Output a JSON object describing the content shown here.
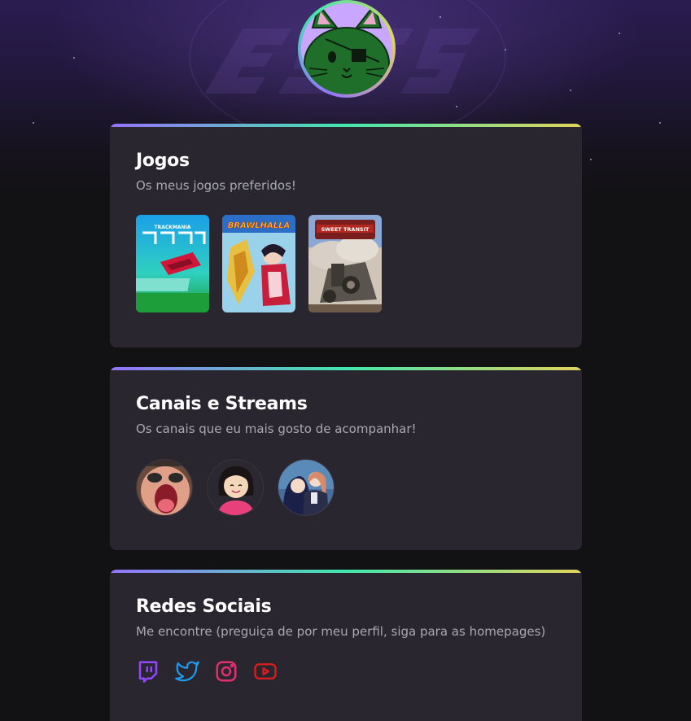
{
  "sections": {
    "games": {
      "title": "Jogos",
      "subtitle": "Os meus jogos preferidos!",
      "items": [
        {
          "name": "Trackmania",
          "label": "TRACKMANIA"
        },
        {
          "name": "Brawlhalla",
          "label": "BRAWLHALLA"
        },
        {
          "name": "Sweet Transit",
          "label": "SWEET TRANSIT"
        }
      ]
    },
    "streams": {
      "title": "Canais e Streams",
      "subtitle": "Os canais que eu mais gosto de acompanhar!"
    },
    "socials": {
      "title": "Redes Sociais",
      "subtitle": "Me encontre (preguiça de por meu perfil, siga para as homepages)",
      "items": [
        {
          "icon": "twitch-icon",
          "color": "#9146ff"
        },
        {
          "icon": "twitter-icon",
          "color": "#1d9bf0"
        },
        {
          "icon": "instagram-icon",
          "color": "#e1306c"
        },
        {
          "icon": "youtube-icon",
          "color": "#e01c1c"
        }
      ]
    }
  },
  "colors": {
    "background": "#121214",
    "card": "#29262f",
    "gradient": [
      "#9572fc",
      "#43e7ad",
      "#e2d45c"
    ],
    "title": "#ffffff",
    "subtitle": "#a8a8b3"
  }
}
